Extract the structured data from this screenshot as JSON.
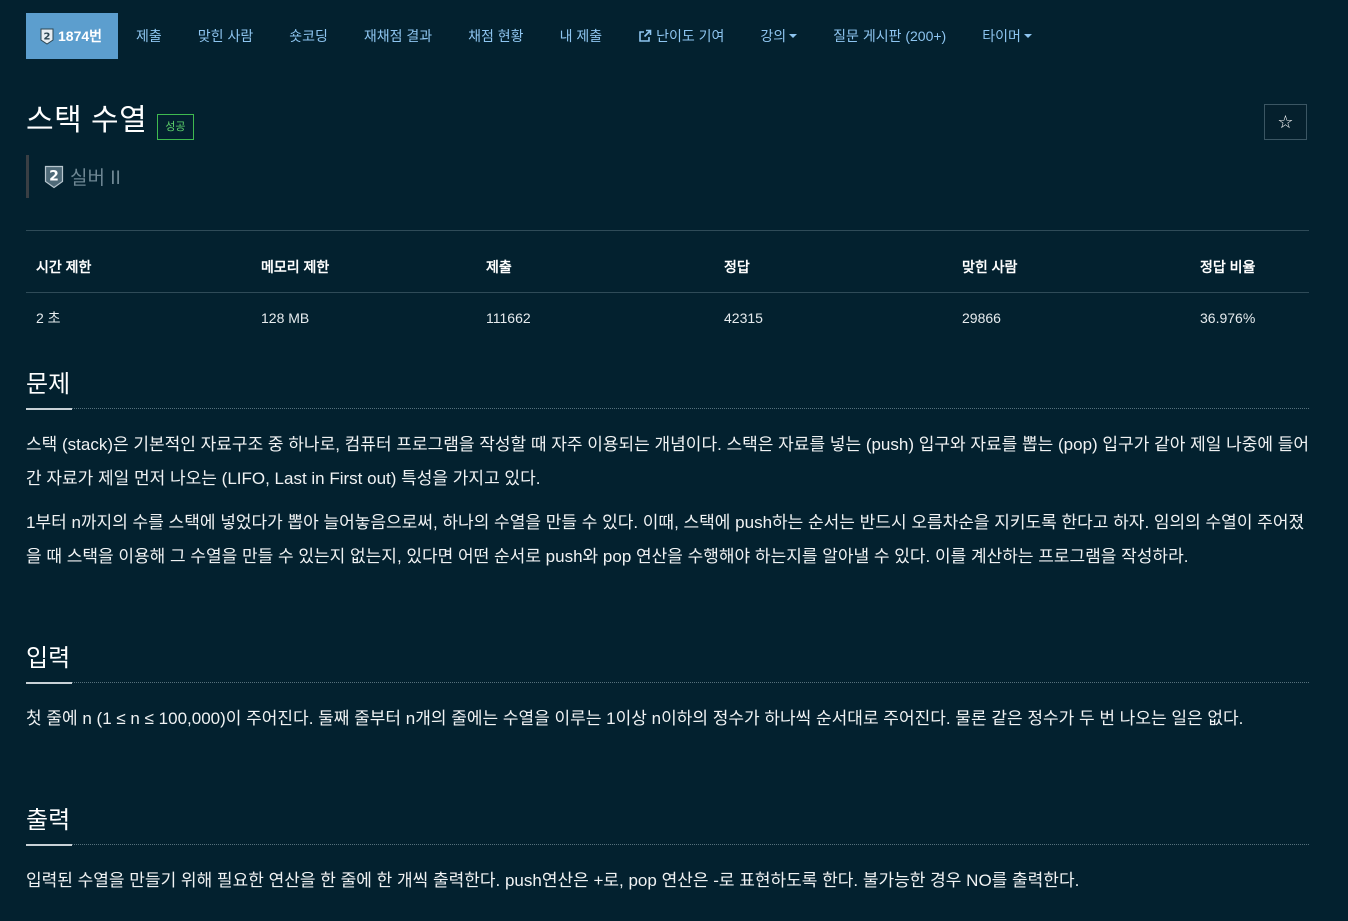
{
  "nav": {
    "problem_number": "1874번",
    "tier_badge_number": "2",
    "tabs": [
      {
        "label": "제출"
      },
      {
        "label": "맞힌 사람"
      },
      {
        "label": "숏코딩"
      },
      {
        "label": "재채점 결과"
      },
      {
        "label": "채점 현황"
      },
      {
        "label": "내 제출"
      },
      {
        "label": "난이도 기여",
        "icon": "external-link-icon"
      },
      {
        "label": "강의",
        "dropdown": true
      },
      {
        "label": "질문 게시판 (200+)"
      },
      {
        "label": "타이머",
        "dropdown": true
      }
    ]
  },
  "problem": {
    "title": "스택 수열",
    "result_label": "성공",
    "tier_text": "실버 II",
    "tier_badge_number": "2",
    "star_icon": "☆"
  },
  "info_table": {
    "headers": [
      "시간 제한",
      "메모리 제한",
      "제출",
      "정답",
      "맞힌 사람",
      "정답 비율"
    ],
    "values": [
      "2 초",
      "128 MB",
      "111662",
      "42315",
      "29866",
      "36.976%"
    ]
  },
  "sections": {
    "description": {
      "heading": "문제",
      "paragraphs": [
        "스택 (stack)은 기본적인 자료구조 중 하나로, 컴퓨터 프로그램을 작성할 때 자주 이용되는 개념이다. 스택은 자료를 넣는 (push) 입구와 자료를 뽑는 (pop) 입구가 같아 제일 나중에 들어간 자료가 제일 먼저 나오는 (LIFO, Last in First out) 특성을 가지고 있다.",
        "1부터 n까지의 수를 스택에 넣었다가 뽑아 늘어놓음으로써, 하나의 수열을 만들 수 있다. 이때, 스택에 push하는 순서는 반드시 오름차순을 지키도록 한다고 하자. 임의의 수열이 주어졌을 때 스택을 이용해 그 수열을 만들 수 있는지 없는지, 있다면 어떤 순서로 push와 pop 연산을 수행해야 하는지를 알아낼 수 있다. 이를 계산하는 프로그램을 작성하라."
      ]
    },
    "input": {
      "heading": "입력",
      "paragraphs": [
        "첫 줄에 n (1 ≤ n ≤ 100,000)이 주어진다. 둘째 줄부터 n개의 줄에는 수열을 이루는 1이상 n이하의 정수가 하나씩 순서대로 주어진다. 물론 같은 정수가 두 번 나오는 일은 없다."
      ]
    },
    "output": {
      "heading": "출력",
      "paragraphs": [
        "입력된 수열을 만들기 위해 필요한 연산을 한 줄에 한 개씩 출력한다. push연산은 +로, pop 연산은 -로 표현하도록 한다. 불가능한 경우 NO를 출력한다."
      ]
    }
  },
  "colors": {
    "background": "#03212f",
    "active_tab": "#5c9ece",
    "tab_link": "#8ec5f0",
    "success": "#5ed26b",
    "tier_silver": "#6e8793"
  }
}
